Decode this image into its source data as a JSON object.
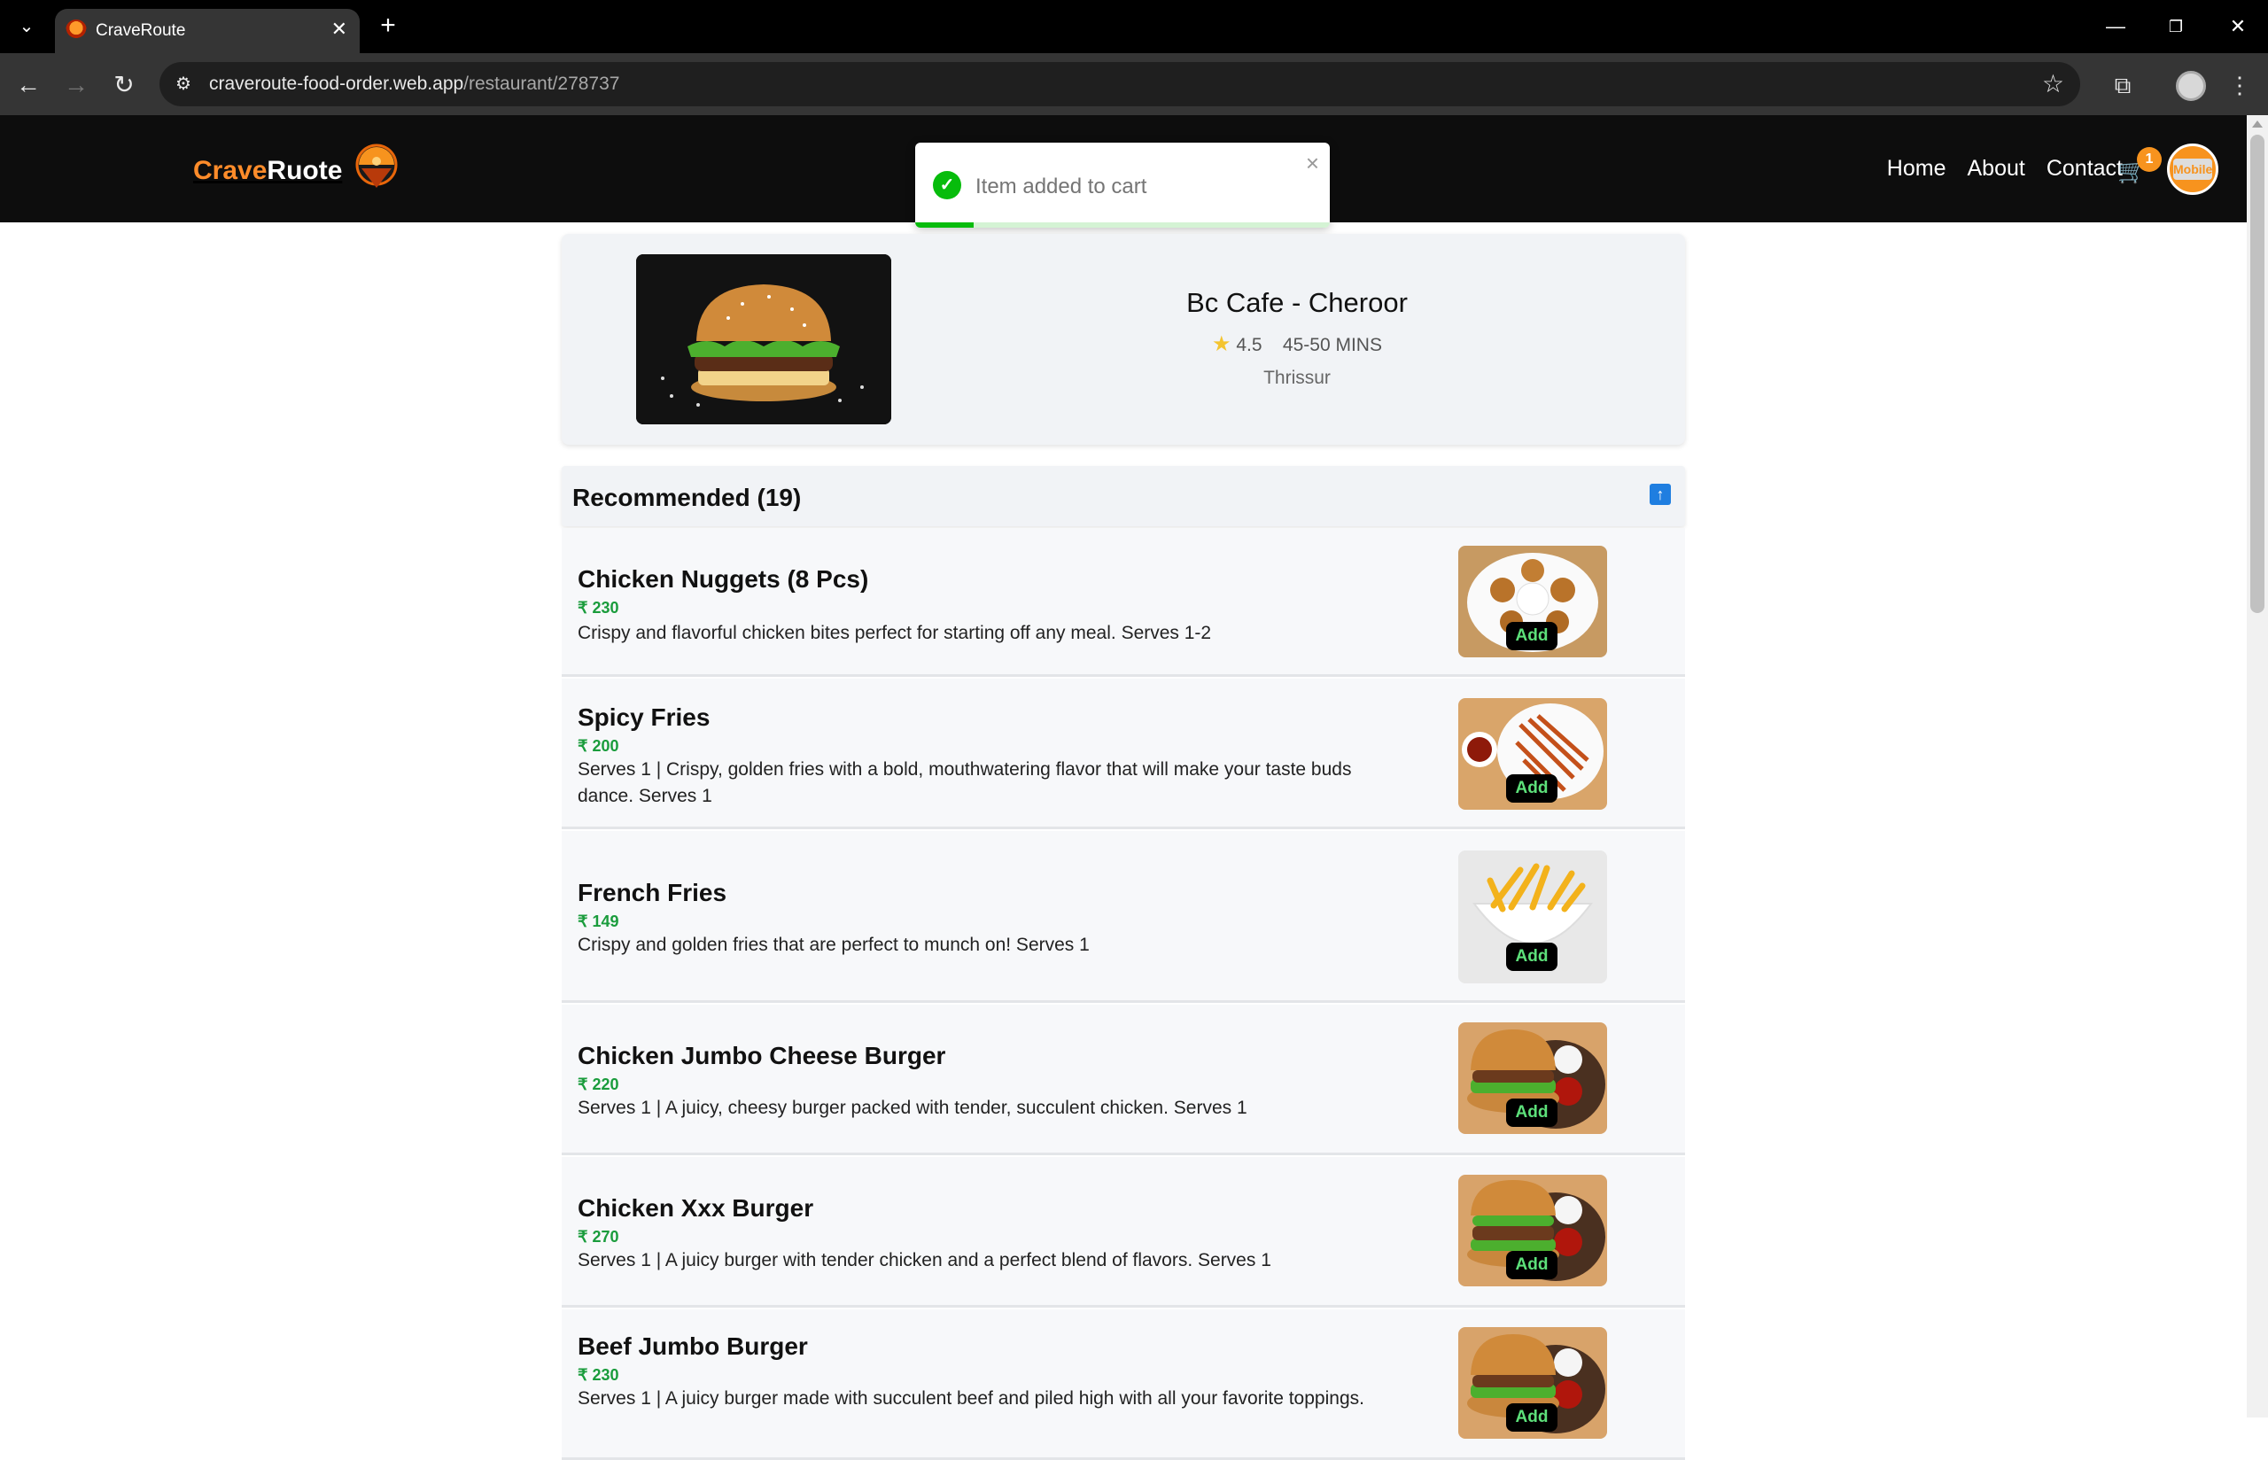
{
  "browser": {
    "tab_title": "CraveRoute",
    "url_host": "craveroute-food-order.web.app",
    "url_path": "/restaurant/278737"
  },
  "header": {
    "logo_part1": "Crave",
    "logo_part2": "Ruote",
    "nav": [
      "Home",
      "About",
      "Contact"
    ],
    "cart_count": "1",
    "avatar_text": "Mobile"
  },
  "toast": {
    "message": "Item added to cart",
    "progress": 0.14
  },
  "restaurant": {
    "name": "Bc Cafe - Cheroor",
    "rating": "4.5",
    "time": "45-50 MINS",
    "location": "Thrissur"
  },
  "menu": {
    "section_title": "Recommended (19)",
    "add_label": "Add",
    "items": [
      {
        "name": "Chicken Nuggets (8 Pcs)",
        "price": "₹ 230",
        "desc": "Crispy and flavorful chicken bites perfect for starting off any meal. Serves 1-2"
      },
      {
        "name": "Spicy Fries",
        "price": "₹ 200",
        "desc": "Serves 1 | Crispy, golden fries with a bold, mouthwatering flavor that will make your taste buds dance. Serves 1"
      },
      {
        "name": "French Fries",
        "price": "₹ 149",
        "desc": "Crispy and golden fries that are perfect to munch on! Serves 1"
      },
      {
        "name": "Chicken Jumbo Cheese Burger",
        "price": "₹ 220",
        "desc": "Serves 1 | A juicy, cheesy burger packed with tender, succulent chicken. Serves 1"
      },
      {
        "name": "Chicken Xxx Burger",
        "price": "₹ 270",
        "desc": "Serves 1 | A juicy burger with tender chicken and a perfect blend of flavors. Serves 1"
      },
      {
        "name": "Beef Jumbo Burger",
        "price": "₹ 230",
        "desc": "Serves 1 | A juicy burger made with succulent beef and piled high with all your favorite toppings."
      }
    ]
  }
}
